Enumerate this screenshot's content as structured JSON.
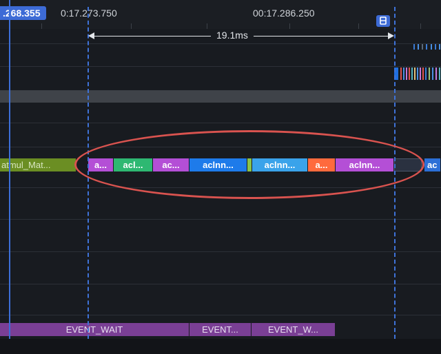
{
  "ruler": {
    "cursor_time": ".268.355",
    "time_left": "0:17.273.750",
    "time_right": "00:17.286.250"
  },
  "measure": {
    "duration": "19.1ms"
  },
  "track_slices": [
    {
      "label": "atmul_Mat...",
      "color": "#6b8e23"
    },
    {
      "label": "a...",
      "color": "#b44fd6"
    },
    {
      "label": "acl...",
      "color": "#2eb872"
    },
    {
      "label": "ac...",
      "color": "#b44fd6"
    },
    {
      "label": "aclnn...",
      "color": "#1e7bea"
    },
    {
      "label": "",
      "color": "#8bc34a"
    },
    {
      "label": "aclnn...",
      "color": "#3aa3ea"
    },
    {
      "label": "a...",
      "color": "#ff6a3d"
    },
    {
      "label": "aclnn...",
      "color": "#b44fd6"
    },
    {
      "label": "",
      "color": "#2a3140"
    },
    {
      "label": "ac",
      "color": "#2b6fd6"
    }
  ],
  "event_slices": [
    {
      "label": "EVENT_WAIT",
      "color": "#7a3f95"
    },
    {
      "label": "EVENT...",
      "color": "#7a3f95"
    },
    {
      "label": "EVENT_W...",
      "color": "#7a3f95"
    }
  ],
  "colors": {
    "cursor": "#3c6fd8",
    "highlight": "#d9534f",
    "background": "#181b20"
  }
}
